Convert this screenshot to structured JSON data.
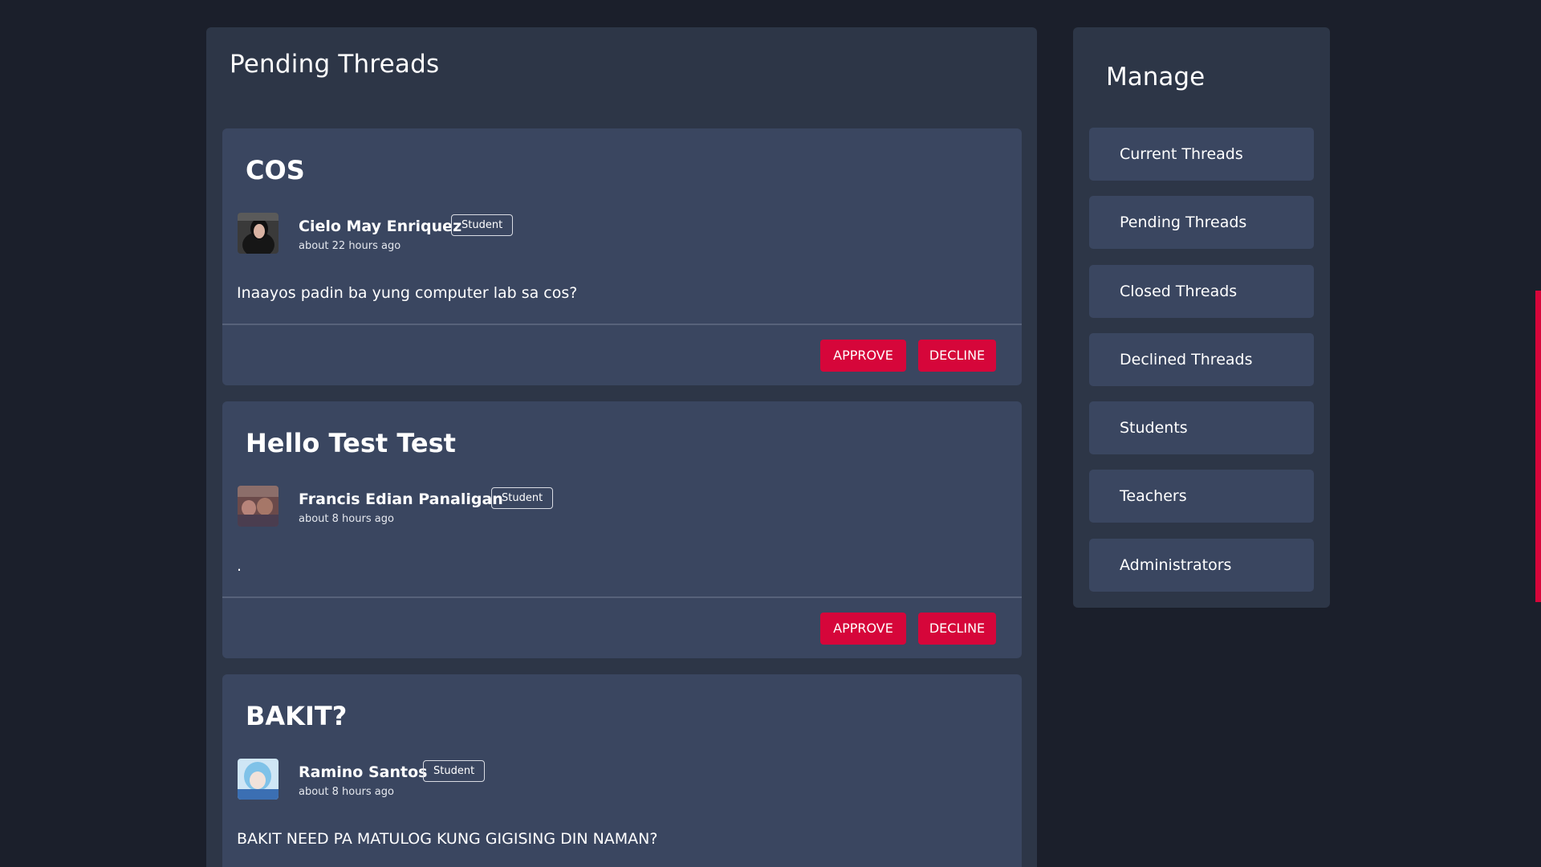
{
  "main": {
    "title": "Pending Threads",
    "approve_label": "APPROVE",
    "decline_label": "DECLINE",
    "threads": [
      {
        "title": "COS",
        "author": "Cielo May Enriquez",
        "role": "Student",
        "time": "about 22 hours ago",
        "body": "Inaayos padin ba yung computer lab sa cos?"
      },
      {
        "title": "Hello Test Test",
        "author": "Francis Edian Panaligan",
        "role": "Student",
        "time": "about 8 hours ago",
        "body": "."
      },
      {
        "title": "BAKIT?",
        "author": "Ramino Santos",
        "role": "Student",
        "time": "about 8 hours ago",
        "body": "BAKIT NEED PA MATULOG KUNG GIGISING DIN NAMAN?"
      }
    ]
  },
  "sidebar": {
    "title": "Manage",
    "items": [
      {
        "label": "Current Threads"
      },
      {
        "label": "Pending Threads"
      },
      {
        "label": "Closed Threads"
      },
      {
        "label": "Declined Threads"
      },
      {
        "label": "Students"
      },
      {
        "label": "Teachers"
      },
      {
        "label": "Administrators"
      }
    ]
  },
  "colors": {
    "background": "#1b1f2b",
    "panel": "#2d3647",
    "card": "#3a4660",
    "accent": "#d6063a"
  }
}
